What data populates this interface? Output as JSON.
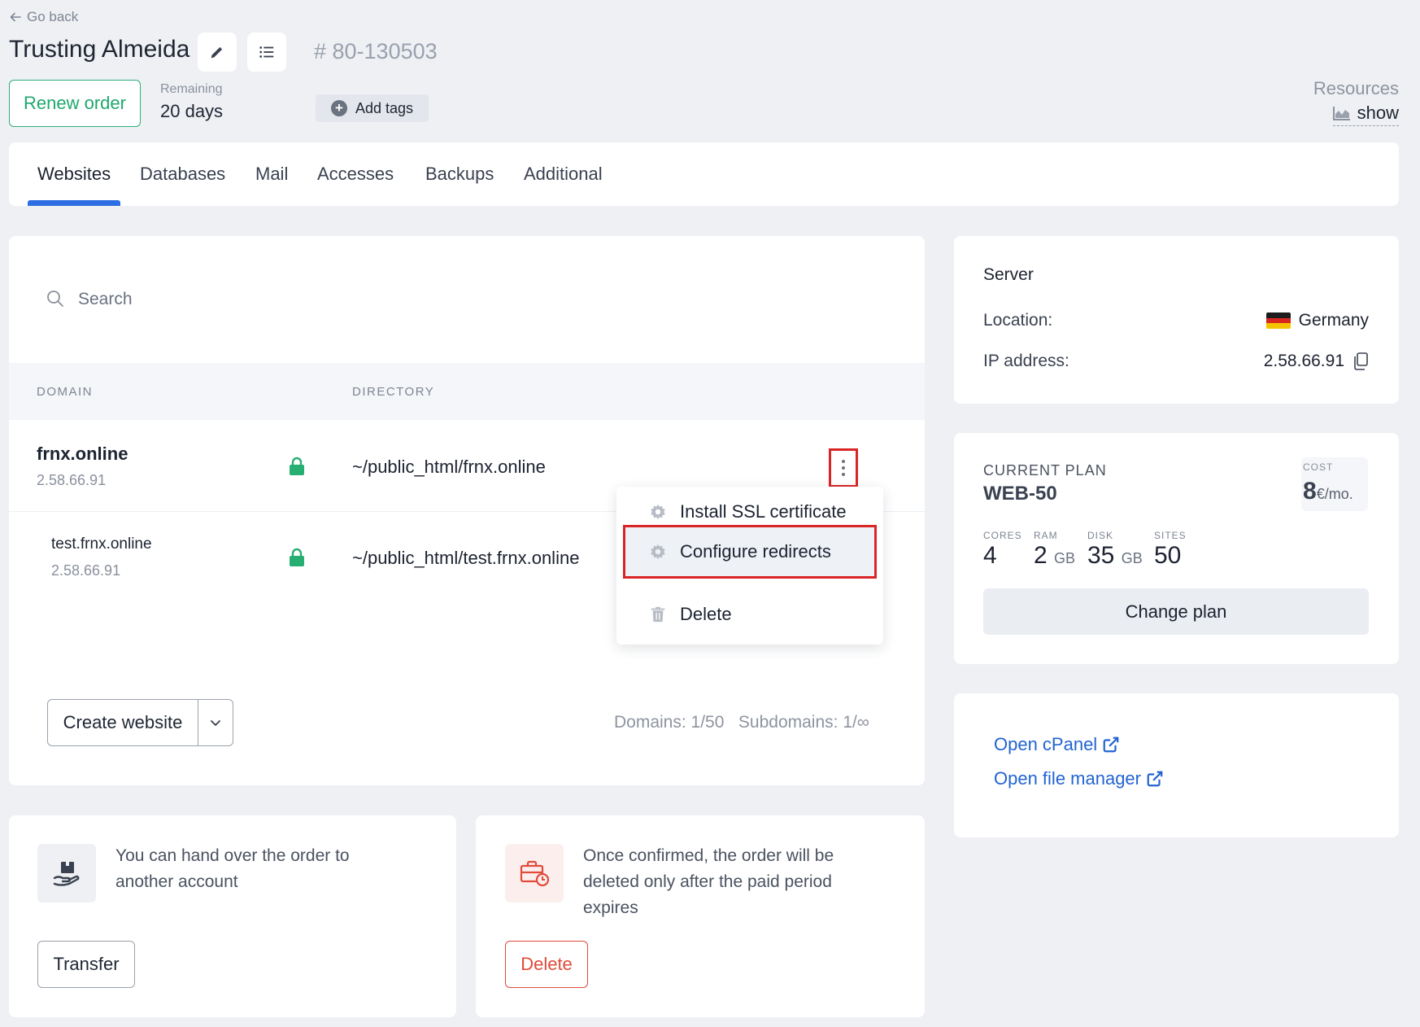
{
  "header": {
    "go_back": "Go back",
    "title": "Trusting Almeida",
    "order_id": "# 80-130503",
    "renew_label": "Renew order",
    "remaining_label": "Remaining",
    "remaining_value": "20 days",
    "add_tags_label": "Add tags",
    "resources_label": "Resources",
    "resources_show": "show"
  },
  "tabs": [
    {
      "label": "Websites",
      "active": true
    },
    {
      "label": "Databases"
    },
    {
      "label": "Mail"
    },
    {
      "label": "Accesses"
    },
    {
      "label": "Backups"
    },
    {
      "label": "Additional"
    }
  ],
  "websites": {
    "search_placeholder": "Search",
    "columns": [
      "DOMAIN",
      "DIRECTORY"
    ],
    "rows": [
      {
        "domain": "frnx.online",
        "ip": "2.58.66.91",
        "directory": "~/public_html/frnx.online"
      },
      {
        "domain": "test.frnx.online",
        "ip": "2.58.66.91",
        "directory": "~/public_html/test.frnx.online"
      }
    ],
    "menu": [
      "Install SSL certificate",
      "Configure redirects",
      "Delete"
    ],
    "create_label": "Create website",
    "counts": "Domains: 1/50   Subdomains: 1/∞"
  },
  "server": {
    "title": "Server",
    "location_label": "Location:",
    "location_value": "Germany",
    "ip_label": "IP address:",
    "ip_value": "2.58.66.91"
  },
  "plan": {
    "label": "CURRENT PLAN",
    "name": "WEB-50",
    "cost_label": "COST",
    "cost_value": "8",
    "cost_unit": "€/mo.",
    "specs": [
      {
        "label": "CORES",
        "value": "4",
        "unit": ""
      },
      {
        "label": "RAM",
        "value": "2",
        "unit": "GB"
      },
      {
        "label": "DISK",
        "value": "35",
        "unit": "GB"
      },
      {
        "label": "SITES",
        "value": "50",
        "unit": ""
      }
    ],
    "change_label": "Change plan"
  },
  "links": {
    "cpanel": "Open cPanel",
    "file_manager": "Open file manager"
  },
  "transfer": {
    "text": "You can hand over the order to another account",
    "button": "Transfer"
  },
  "delete_order": {
    "text": "Once confirmed, the order will be deleted only after the paid period expires",
    "button": "Delete"
  },
  "colors": {
    "accent": "#2d6fe3",
    "success": "#1ea86d",
    "danger": "#e04b3a",
    "highlight": "#d92525",
    "link": "#2264d1"
  }
}
